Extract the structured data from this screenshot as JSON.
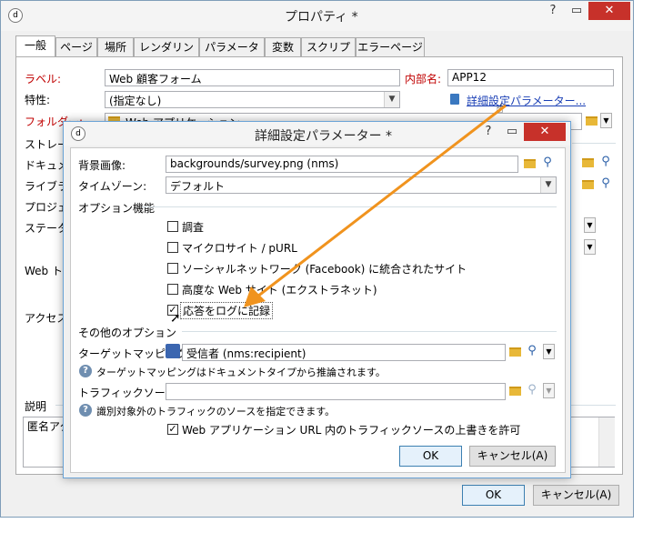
{
  "main": {
    "title": "プロパティ *",
    "window_controls": [
      "?",
      "✕"
    ],
    "tabs": [
      "一般",
      "ページ",
      "場所",
      "レンダリング",
      "パラメーター",
      "変数",
      "スクリプト",
      "エラーページ"
    ],
    "label_label": "ラベル:",
    "label_value": "Web 顧客フォーム",
    "internal_name_label": "内部名:",
    "internal_name_value": "APP12",
    "nature_label": "特性:",
    "nature_value": "(指定なし)",
    "advanced_link": "詳細設定パラメーター...",
    "folder_label": "フォルダー:",
    "folder_value": "Web アプリケーション",
    "storage_label": "ストレージ",
    "document_label": "ドキュメン",
    "library_label": "ライブラリ",
    "project_label": "プロジェク",
    "status_label": "ステータス",
    "web_label": "Web ト",
    "access_label": "アクセス制",
    "description_label": "説明",
    "description_value": "匿名アク",
    "ok_label": "OK",
    "cancel_label": "キャンセル(A)"
  },
  "dialog": {
    "title": "詳細設定パラメーター *",
    "bg_image_label": "背景画像:",
    "bg_image_value": "backgrounds/survey.png (nms)",
    "timezone_label": "タイムゾーン:",
    "timezone_value": "デフォルト",
    "options_section": "オプション機能",
    "options": [
      {
        "label": "調査",
        "checked": false
      },
      {
        "label": "マイクロサイト / pURL",
        "checked": false
      },
      {
        "label": "ソーシャルネットワーク (Facebook) に統合されたサイト",
        "checked": false
      },
      {
        "label": "高度な Web サイト (エクストラネット)",
        "checked": false
      },
      {
        "label": "応答をログに記録",
        "checked": true
      }
    ],
    "other_section": "その他のオプション",
    "target_mapping_label": "ターゲットマッピング:",
    "target_mapping_value": "受信者 (nms:recipient)",
    "target_help": "ターゲットマッピングはドキュメントタイプから推論されます。",
    "traffic_label": "トラフィックソース:",
    "traffic_value": "",
    "traffic_help": "識別対象外のトラフィックのソースを指定できます。",
    "overwrite_label": "Web アプリケーション URL 内のトラフィックソースの上書きを許可",
    "overwrite_checked": true,
    "ok_label": "OK",
    "cancel_label": "キャンセル(A)"
  },
  "accent_color": "#f0931e"
}
